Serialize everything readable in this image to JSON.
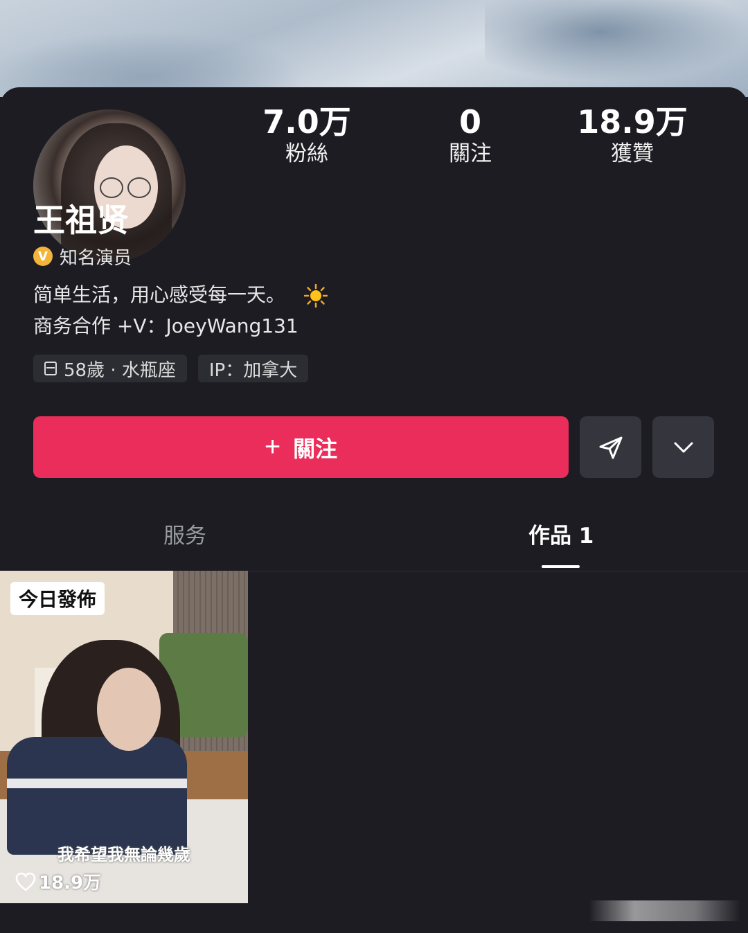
{
  "profile": {
    "name": "王祖贤",
    "verified_label": "知名演员",
    "verified_badge": "V",
    "bio_line1": "简单生活，用心感受每一天。",
    "bio_line2": "商务合作 +V：JoeyWang131",
    "tags": [
      "58歲 · 水瓶座",
      "IP：加拿大"
    ]
  },
  "stats": [
    {
      "value": "7.0万",
      "label": "粉絲"
    },
    {
      "value": "0",
      "label": "關注"
    },
    {
      "value": "18.9万",
      "label": "獲贊"
    }
  ],
  "actions": {
    "follow_plus": "+",
    "follow_label": "關注"
  },
  "tabs": [
    {
      "label": "服务"
    },
    {
      "label": "作品 1"
    }
  ],
  "videos": [
    {
      "badge": "今日發佈",
      "caption": "我希望我無論幾歲",
      "likes": "18.9万"
    }
  ],
  "colors": {
    "background": "#1c1c22",
    "accent": "#ea2d5a",
    "verified": "#f2b43a",
    "secondary_button": "#35353d"
  }
}
